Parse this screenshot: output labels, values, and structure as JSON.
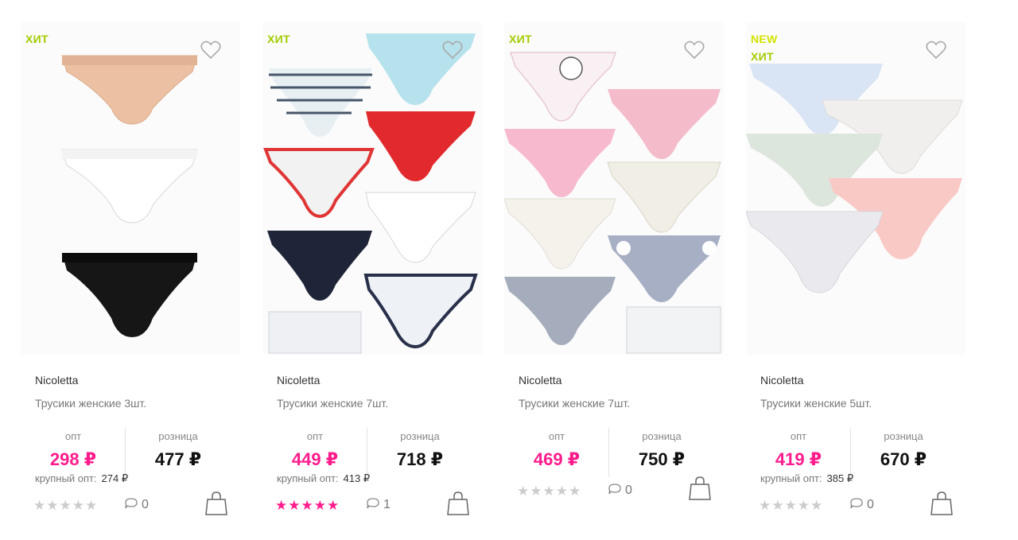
{
  "colors": {
    "accent_price": "#ff1c8d",
    "badge_hit": "#a3cc00",
    "badge_new": "#d4e400",
    "star_active": "#ff1c8d",
    "star_inactive": "#cccccc"
  },
  "labels": {
    "opt": "опт",
    "retail": "розница",
    "bulk": "крупный опт:"
  },
  "products": [
    {
      "badges": [
        "ХИТ"
      ],
      "brand": "Nicoletta",
      "title": "Трусики женские 3шт.",
      "price_opt": "298 ₽",
      "price_retail": "477 ₽",
      "price_bulk": "274 ₽",
      "rating": 0,
      "comments": "0",
      "icons": {
        "favorite": "heart-icon",
        "cart": "shopping-bag-icon",
        "comment": "speech-bubble-icon"
      }
    },
    {
      "badges": [
        "ХИТ"
      ],
      "brand": "Nicoletta",
      "title": "Трусики женские 7шт.",
      "price_opt": "449 ₽",
      "price_retail": "718 ₽",
      "price_bulk": "413 ₽",
      "rating": 5,
      "comments": "1",
      "icons": {
        "favorite": "heart-icon",
        "cart": "shopping-bag-icon",
        "comment": "speech-bubble-icon"
      }
    },
    {
      "badges": [
        "ХИТ"
      ],
      "brand": "Nicoletta",
      "title": "Трусики женские 7шт.",
      "price_opt": "469 ₽",
      "price_retail": "750 ₽",
      "price_bulk": null,
      "rating": 0,
      "comments": "0",
      "icons": {
        "favorite": "heart-icon",
        "cart": "shopping-bag-icon",
        "comment": "speech-bubble-icon"
      }
    },
    {
      "badges": [
        "NEW",
        "ХИТ"
      ],
      "brand": "Nicoletta",
      "title": "Трусики женские 5шт.",
      "price_opt": "419 ₽",
      "price_retail": "670 ₽",
      "price_bulk": "385 ₽",
      "rating": 0,
      "comments": "0",
      "icons": {
        "favorite": "heart-icon",
        "cart": "shopping-bag-icon",
        "comment": "speech-bubble-icon"
      }
    }
  ]
}
